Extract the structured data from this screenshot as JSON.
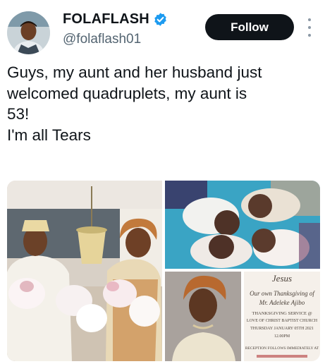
{
  "tweet": {
    "author": {
      "display_name": "FOLAFLASH",
      "handle": "@folaflash01",
      "verified": true,
      "verified_color": "#1d9bf0"
    },
    "follow_label": "Follow",
    "more_icon": "more-vertical-icon",
    "text": "Guys, my aunt and her husband just\nwelcomed quadruplets, my aunt is\n53!\nI'm all Tears"
  },
  "media": {
    "card": {
      "line1": "Jesus",
      "line2": "Our own Thanksgiving of",
      "line3": "Mr. Adeleke Ajibo",
      "line4": "THANKSGIVING SERVICE @",
      "line5": "LOVE OF CHRIST BAPTIST CHURCH",
      "line6": "THURSDAY JANUARY 05TH 2021",
      "line7": "12.00PM",
      "line8": "RECEPTION FOLLOWS IMMEDIATELY AT"
    }
  },
  "colors": {
    "button_bg": "#0f1419",
    "secondary_text": "#536471"
  }
}
